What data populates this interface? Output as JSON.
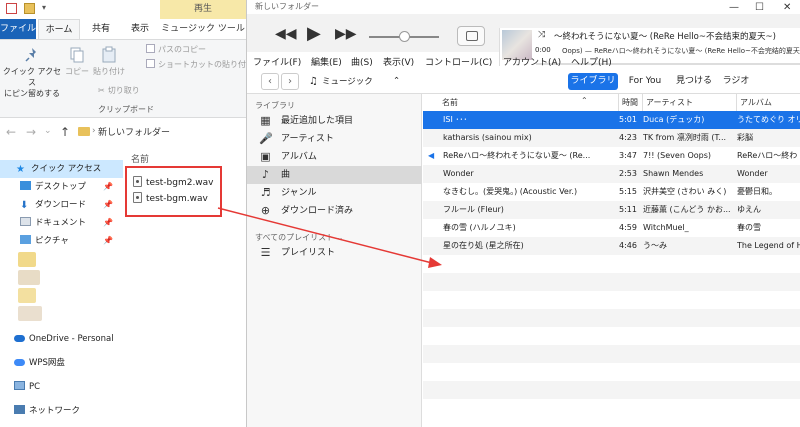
{
  "explorer": {
    "context_tab": "再生",
    "tabs": [
      "ファイル",
      "ホーム",
      "共有",
      "表示",
      "ミュージック ツール"
    ],
    "ribbon": {
      "pin_label_1": "クイック アクセス",
      "pin_label_2": "にピン留めする",
      "copy_label": "コピー",
      "paste_label": "貼り付け",
      "copy_path": "パスのコピー",
      "paste_shortcut": "ショートカットの貼り付け",
      "cut": "切り取り",
      "group_clipboard": "クリップボード"
    },
    "address": {
      "path": "新しいフォルダー"
    },
    "nav": [
      {
        "label": "クイック アクセス"
      },
      {
        "label": "デスクトップ"
      },
      {
        "label": "ダウンロード"
      },
      {
        "label": "ドキュメント"
      },
      {
        "label": "ピクチャ"
      },
      {
        "label": "OneDrive - Personal"
      },
      {
        "label": "WPS网盘"
      },
      {
        "label": "PC"
      },
      {
        "label": "ネットワーク"
      }
    ],
    "column_header": "名前",
    "files": [
      "test-bgm2.wav",
      "test-bgm.wav"
    ]
  },
  "itunes": {
    "window_title": "新しいフォルダー",
    "now_playing": {
      "title": "～終われそうにない夏～ (ReRe Hello~不会结束的夏天~)",
      "subtitle": "Oops) — ReReハロ〜終われそうにない夏〜 (ReRe Hello~不会完结的夏天",
      "time": "0:00"
    },
    "menu": [
      "ファイル(F)",
      "編集(E)",
      "曲(S)",
      "表示(V)",
      "コントロール(C)",
      "アカウント(A)",
      "ヘルプ(H)"
    ],
    "media_kind": "ミュージック",
    "tabs": [
      "ライブラリ",
      "For You",
      "見つける",
      "ラジオ"
    ],
    "sidebar": {
      "library_header": "ライブラリ",
      "items": [
        "最近追加した項目",
        "アーティスト",
        "アルバム",
        "曲",
        "ジャンル",
        "ダウンロード済み"
      ],
      "playlists_header": "すべてのプレイリスト ⌄",
      "playlist": "プレイリスト"
    },
    "columns": {
      "name": "名前",
      "time": "時間",
      "artist": "アーティスト",
      "album": "アルバム"
    },
    "songs": [
      {
        "name": "ISI ･･･",
        "time": "5:01",
        "artist": "Duca (デュッカ)",
        "album": "うたてめぐり オリジ"
      },
      {
        "name": "katharsis (sainou mix)",
        "time": "4:23",
        "artist": "TK from 凛冽时雨 (T...",
        "album": "彩脳"
      },
      {
        "name": "ReReハロ〜終われそうにない夏〜 (Re...",
        "time": "3:47",
        "artist": "7!! (Seven Oops)",
        "album": "ReReハロ〜終わ"
      },
      {
        "name": "Wonder",
        "time": "2:53",
        "artist": "Shawn Mendes",
        "album": "Wonder"
      },
      {
        "name": "なきむし。(爱哭鬼。) (Acoustic Ver.)",
        "time": "5:15",
        "artist": "沢井美空 (さわい みく)",
        "album": "憂鬱日和。"
      },
      {
        "name": "フルール (Fleur)",
        "time": "5:11",
        "artist": "近藤薫 (こんどう かお...",
        "album": "ゆえん"
      },
      {
        "name": "春の雪 (ハルノユキ)",
        "time": "4:59",
        "artist": "WitchMuel_",
        "album": "春の雪"
      },
      {
        "name": "星の在り処 (星之所在)",
        "time": "4:46",
        "artist": "う～み",
        "album": "The Legend of H"
      }
    ]
  },
  "colors": {
    "accent": "#1a73e8",
    "annotation": "#e53935",
    "file_tab": "#1a63b8"
  }
}
